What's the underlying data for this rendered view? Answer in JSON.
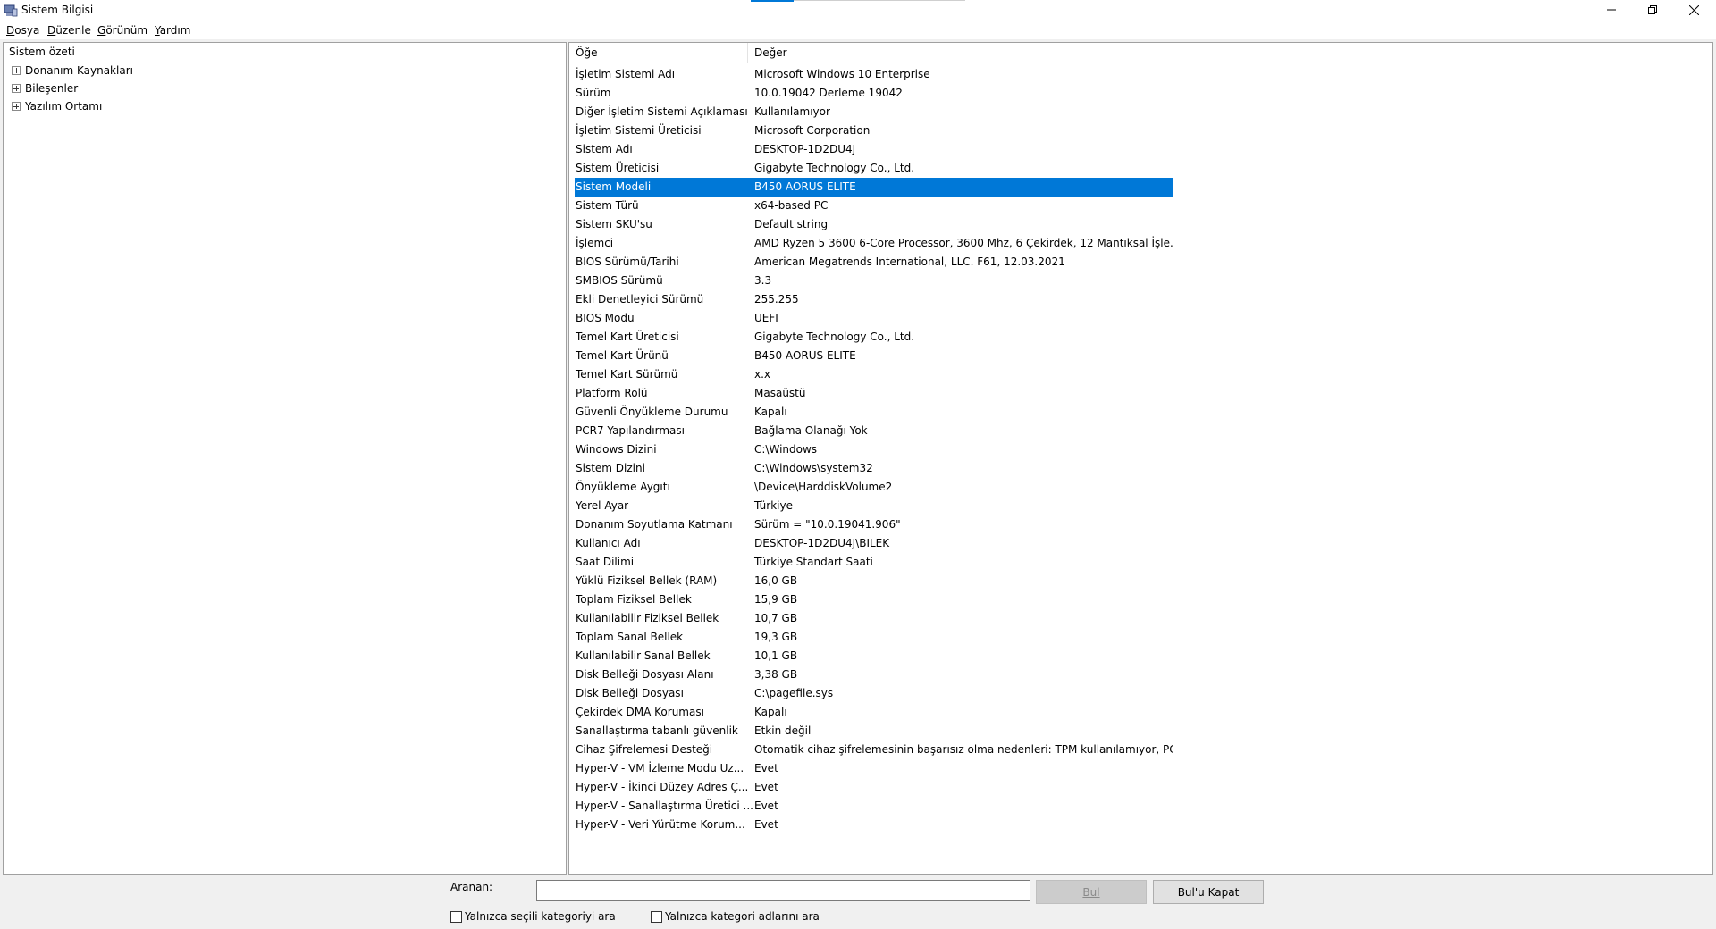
{
  "window": {
    "title": "Sistem Bilgisi"
  },
  "menu": [
    {
      "u": "D",
      "rest": "osya"
    },
    {
      "u": "D",
      "rest": "üzenle"
    },
    {
      "u": "G",
      "rest": "örünüm"
    },
    {
      "u": "Y",
      "rest": "ardım"
    }
  ],
  "tree": {
    "root": "Sistem özeti",
    "nodes": [
      "Donanım Kaynakları",
      "Bileşenler",
      "Yazılım Ortamı"
    ]
  },
  "list": {
    "col_item": "Öğe",
    "col_value": "Değer",
    "selected_index": 6,
    "rows": [
      [
        "İşletim Sistemi Adı",
        "Microsoft Windows 10 Enterprise"
      ],
      [
        "Sürüm",
        "10.0.19042 Derleme 19042"
      ],
      [
        "Diğer İşletim Sistemi Açıklaması",
        "Kullanılamıyor"
      ],
      [
        "İşletim Sistemi Üreticisi",
        "Microsoft Corporation"
      ],
      [
        "Sistem Adı",
        "DESKTOP-1D2DU4J"
      ],
      [
        "Sistem Üreticisi",
        "Gigabyte Technology Co., Ltd."
      ],
      [
        "Sistem Modeli",
        "B450 AORUS ELITE"
      ],
      [
        "Sistem Türü",
        "x64-based PC"
      ],
      [
        "Sistem SKU'su",
        "Default string"
      ],
      [
        "İşlemci",
        "AMD Ryzen 5 3600 6-Core Processor, 3600 Mhz, 6 Çekirdek, 12 Mantıksal İşle..."
      ],
      [
        "BIOS Sürümü/Tarihi",
        "American Megatrends International, LLC. F61, 12.03.2021"
      ],
      [
        "SMBIOS Sürümü",
        "3.3"
      ],
      [
        "Ekli Denetleyici Sürümü",
        "255.255"
      ],
      [
        "BIOS Modu",
        "UEFI"
      ],
      [
        "Temel Kart Üreticisi",
        "Gigabyte Technology Co., Ltd."
      ],
      [
        "Temel Kart Ürünü",
        "B450 AORUS ELITE"
      ],
      [
        "Temel Kart Sürümü",
        "x.x"
      ],
      [
        "Platform Rolü",
        "Masaüstü"
      ],
      [
        "Güvenli Önyükleme Durumu",
        "Kapalı"
      ],
      [
        "PCR7 Yapılandırması",
        "Bağlama Olanağı Yok"
      ],
      [
        "Windows Dizini",
        "C:\\Windows"
      ],
      [
        "Sistem Dizini",
        "C:\\Windows\\system32"
      ],
      [
        "Önyükleme Aygıtı",
        "\\Device\\HarddiskVolume2"
      ],
      [
        "Yerel Ayar",
        "Türkiye"
      ],
      [
        "Donanım Soyutlama Katmanı",
        "Sürüm = \"10.0.19041.906\""
      ],
      [
        "Kullanıcı Adı",
        "DESKTOP-1D2DU4J\\BILEK"
      ],
      [
        "Saat Dilimi",
        "Türkiye Standart Saati"
      ],
      [
        "Yüklü Fiziksel Bellek (RAM)",
        "16,0 GB"
      ],
      [
        "Toplam Fiziksel Bellek",
        "15,9 GB"
      ],
      [
        "Kullanılabilir Fiziksel Bellek",
        "10,7 GB"
      ],
      [
        "Toplam Sanal Bellek",
        "19,3 GB"
      ],
      [
        "Kullanılabilir Sanal Bellek",
        "10,1 GB"
      ],
      [
        "Disk Belleği Dosyası Alanı",
        "3,38 GB"
      ],
      [
        "Disk Belleği Dosyası",
        "C:\\pagefile.sys"
      ],
      [
        "Çekirdek DMA Koruması",
        "Kapalı"
      ],
      [
        "Sanallaştırma tabanlı güvenlik",
        "Etkin değil"
      ],
      [
        "Cihaz Şifrelemesi Desteği",
        "Otomatik cihaz şifrelemesinin başarısız olma nedenleri: TPM kullanılamıyor, PC..."
      ],
      [
        "Hyper-V - VM İzleme Modu Uz...",
        "Evet"
      ],
      [
        "Hyper-V - İkinci Düzey Adres Ç...",
        "Evet"
      ],
      [
        "Hyper-V - Sanallaştırma Üretici ...",
        "Evet"
      ],
      [
        "Hyper-V - Veri Yürütme Korum...",
        "Evet"
      ]
    ]
  },
  "search": {
    "label": "Aranan:",
    "value": "",
    "find_label": "Bul",
    "close_label": "Bul'u Kapat",
    "opt_selected_only": "Yalnızca seçili kategoriyi ara",
    "opt_names_only": "Yalnızca kategori adlarını ara"
  },
  "colors": {
    "accent": "#0078d7",
    "selection_text": "#ffffff",
    "window_bg": "#f0f0f0"
  }
}
